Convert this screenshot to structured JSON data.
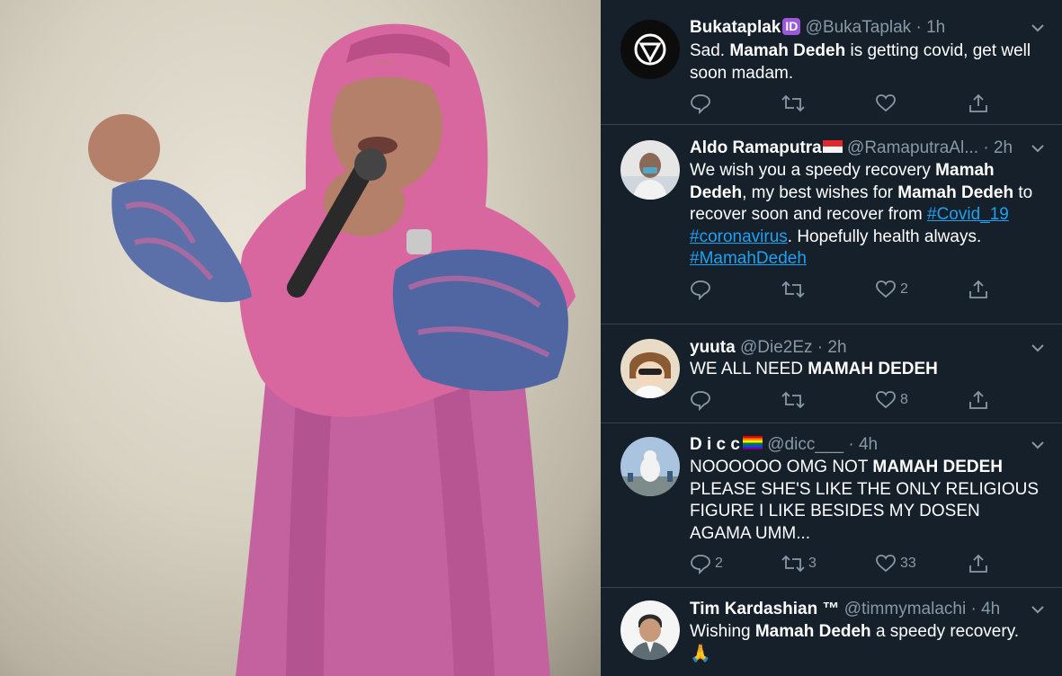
{
  "tweets": [
    {
      "name": "Bukataplak",
      "badge": "ID",
      "handle": "@BukaTaplak",
      "time": "1h",
      "text_parts": [
        "Sad. ",
        "Mamah Dedeh",
        " is getting covid, get well soon madam."
      ],
      "replies": "",
      "retweets": "",
      "likes": ""
    },
    {
      "name": "Aldo Ramaputra",
      "handle": "@RamaputraAl...",
      "time": "2h",
      "text_parts": [
        "We wish you a speedy recovery ",
        "Mamah Dedeh",
        ", my best wishes for ",
        "Mamah Dedeh",
        " to recover soon and recover from "
      ],
      "hashtags": [
        "#Covid_19",
        "#coronavirus",
        "#MamahDedeh"
      ],
      "text_after": ". Hopefully health always.",
      "replies": "",
      "retweets": "",
      "likes": "2"
    },
    {
      "name": "yuuta",
      "handle": "@Die2Ez",
      "time": "2h",
      "text_parts": [
        "WE ALL NEED ",
        "MAMAH DEDEH"
      ],
      "replies": "",
      "retweets": "",
      "likes": "8"
    },
    {
      "name": "D i c c",
      "handle": "@dicc___",
      "time": "4h",
      "text_parts": [
        "NOOOOOO OMG NOT ",
        "MAMAH DEDEH",
        " PLEASE SHE'S LIKE THE ONLY RELIGIOUS FIGURE I LIKE BESIDES MY DOSEN AGAMA UMM..."
      ],
      "replies": "2",
      "retweets": "3",
      "likes": "33"
    },
    {
      "name": "Tim Kardashian ™",
      "handle": "@timmymalachi",
      "time": "4h",
      "text_parts": [
        "Wishing ",
        "Mamah Dedeh",
        " a speedy recovery."
      ],
      "emoji": "🙏"
    }
  ],
  "sep": " · ",
  "colors": {
    "background": "#15202b",
    "text": "#ffffff",
    "muted": "#8899a6",
    "link": "#1da1f2",
    "divider": "#38444d",
    "badge": "#9b59d8",
    "dress": "#c45a9b"
  },
  "icons": [
    "reply-icon",
    "retweet-icon",
    "like-icon",
    "share-icon",
    "chevron-down-icon"
  ]
}
